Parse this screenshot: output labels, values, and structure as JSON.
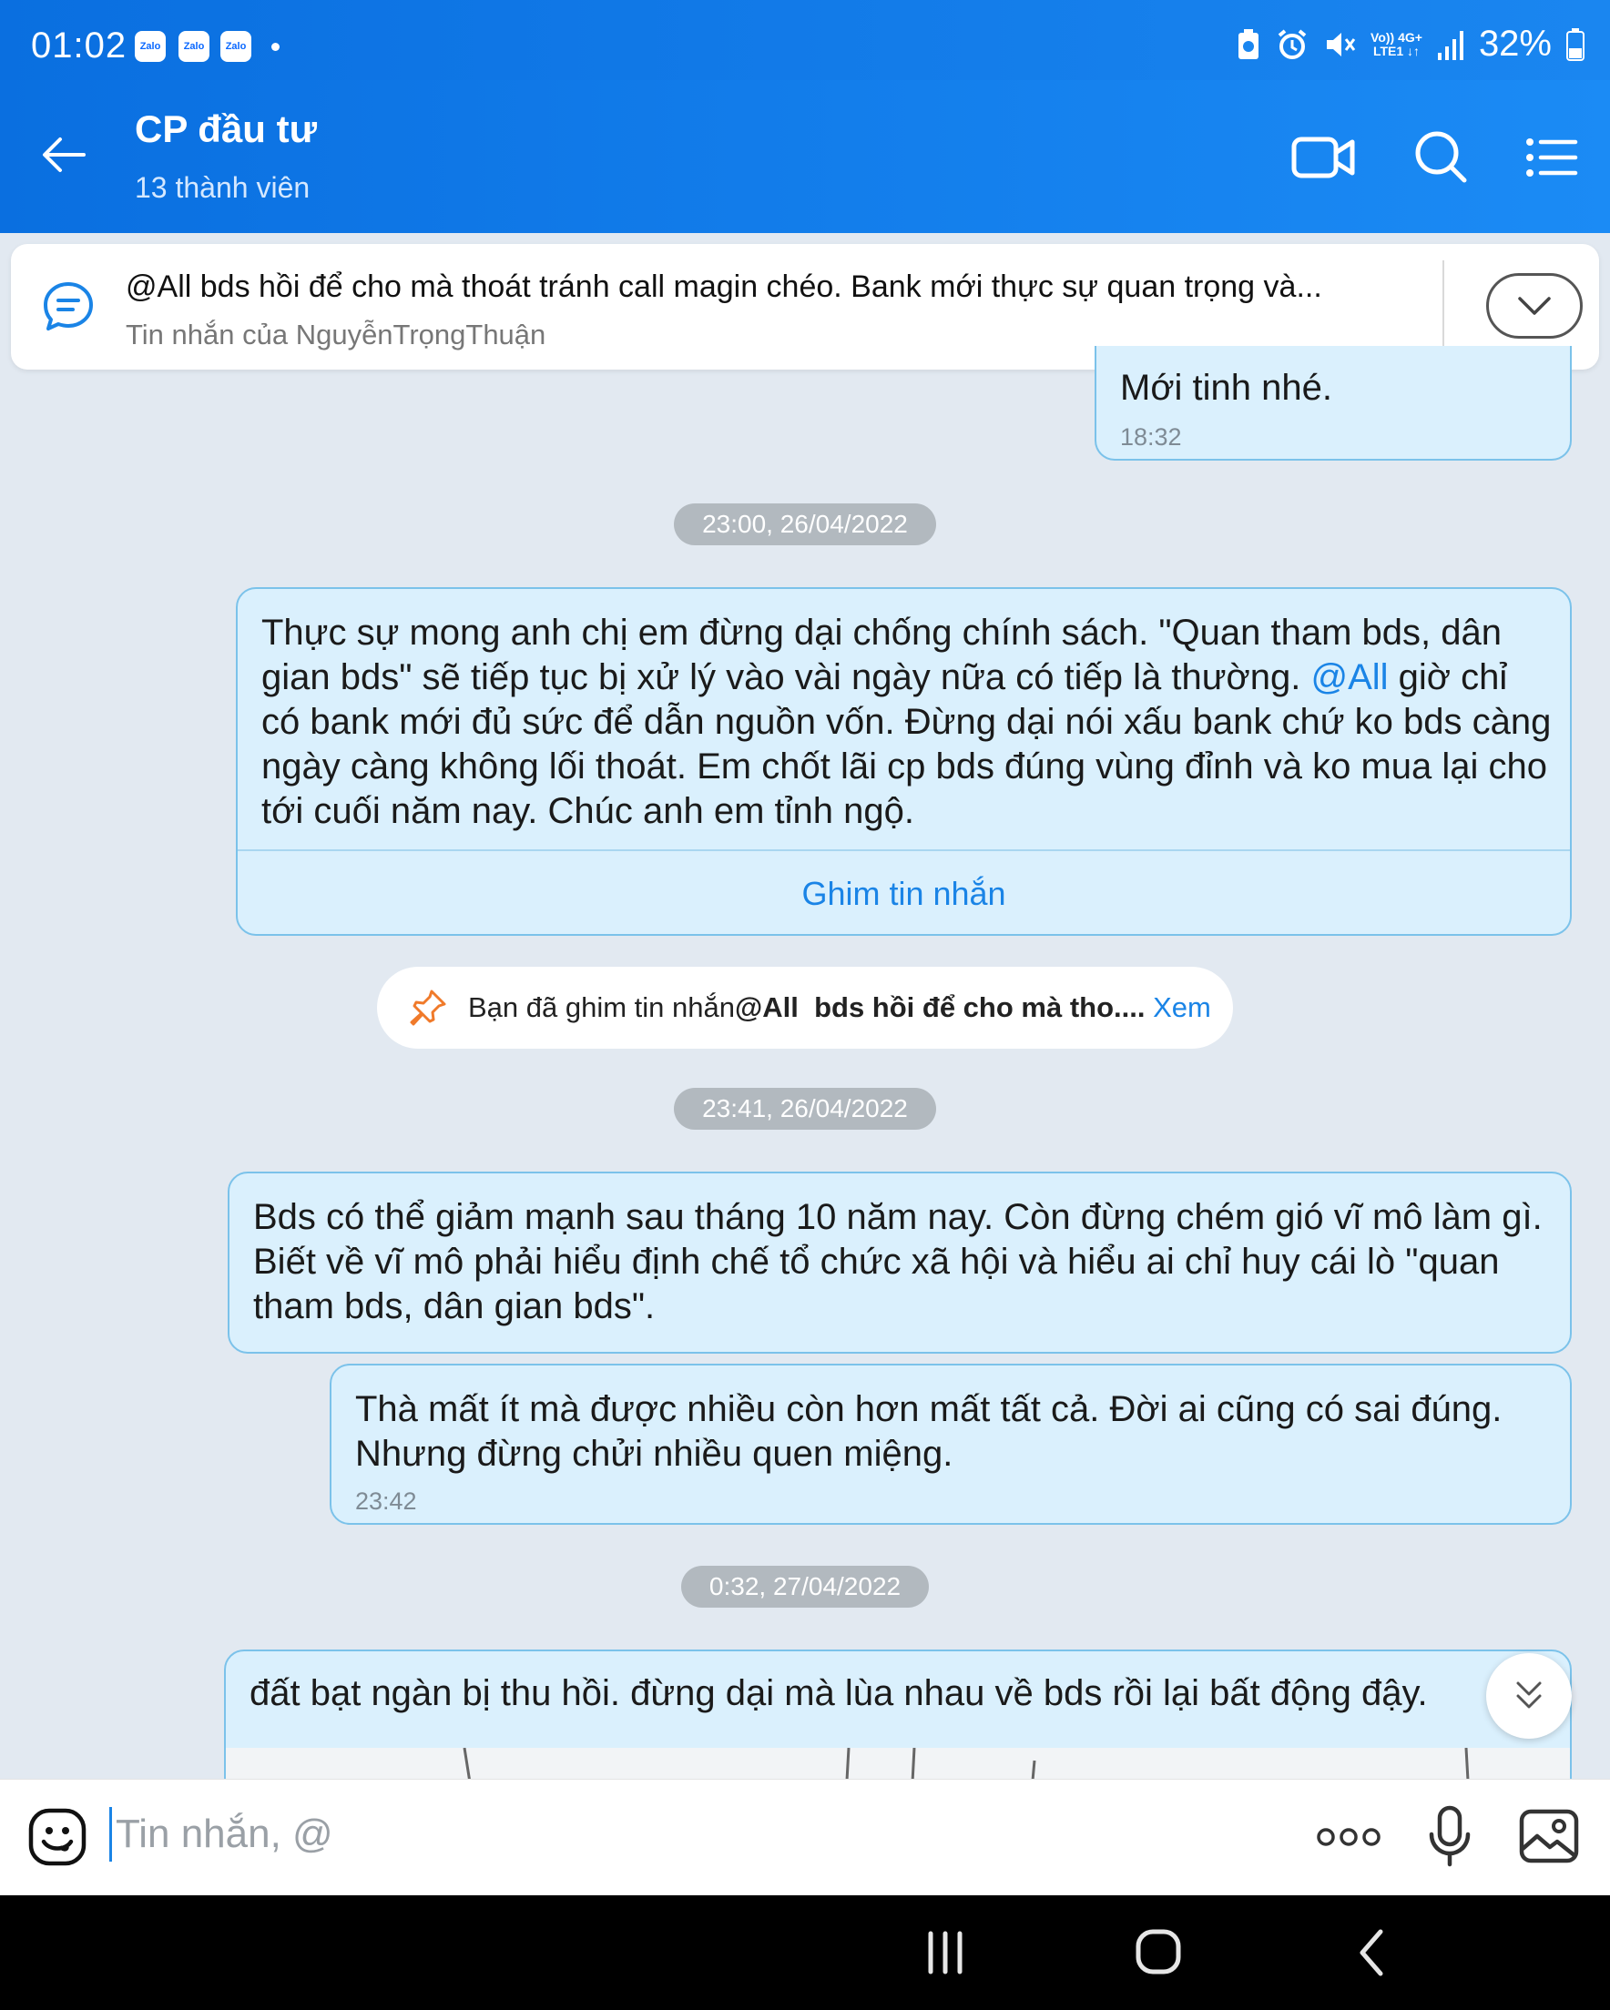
{
  "status_bar": {
    "time": "01:02",
    "notifications": [
      "Zalo",
      "Zalo",
      "Zalo"
    ],
    "network_top": "Vo)) 4G+",
    "network_bottom": "LTE1 ↓↑",
    "battery": "32%"
  },
  "header": {
    "title": "CP đầu tư",
    "subtitle": "13 thành viên"
  },
  "pinned": {
    "text": "@All  bds hồi để cho mà thoát tránh call magin chéo. Bank mới thực sự quan trọng và...",
    "sub": "Tin nhắn của NguyễnTrọngThuận"
  },
  "messages": {
    "m0": {
      "text": "Mới tinh nhé.",
      "time": "18:32"
    },
    "date1": "23:00, 26/04/2022",
    "m1": {
      "text_before": "Thực sự mong anh chị em đừng dại chống chính sách. \"Quan tham bds, dân gian bds\" sẽ tiếp tục bị xử lý vào vài ngày nữa có tiếp là thường. ",
      "mention": "@All",
      "text_after": " giờ chỉ có bank mới đủ sức để dẫn nguồn vốn. Đừng dại nói xấu bank chứ ko bds càng ngày càng không lối thoát. Em chốt lãi cp bds đúng vùng đỉnh và ko mua lại cho tới cuối năm nay. Chúc anh em tỉnh ngộ.",
      "action": "Ghim tin nhắn"
    },
    "pin_notice": {
      "prefix": "Bạn đã ghim tin nhắn ",
      "bold": "@All  bds hồi để cho mà tho....",
      "link": " Xem"
    },
    "date2": "23:41, 26/04/2022",
    "m2": {
      "text": "Bds có thể giảm mạnh sau tháng 10 năm nay. Còn đừng chém gió vĩ mô làm gì. Biết về vĩ mô phải hiểu định chế tổ chức xã hội và hiểu ai chỉ huy cái lò \"quan tham bds, dân gian bds\"."
    },
    "m3": {
      "text": "Thà mất ít mà được nhiều còn hơn mất tất cả. Đời ai cũng có sai đúng. Nhưng đừng chửi nhiều quen miệng.",
      "time": "23:42"
    },
    "date3": "0:32, 27/04/2022",
    "m4": {
      "text": "đất bạt ngàn bị thu hồi. đừng dại mà lùa nhau về bds rồi lại bất động đậy."
    }
  },
  "input": {
    "placeholder": "Tin nhắn, @"
  },
  "colors": {
    "accent": "#1a84e6",
    "header": "#0a6fe0",
    "bubble": "#daf0fd",
    "bubble_border": "#7bc2ea",
    "pin_icon": "#f07a2a"
  },
  "icons": [
    "back-arrow-icon",
    "video-call-icon",
    "search-icon",
    "menu-list-icon",
    "chat-bubble-icon",
    "chevron-down-icon",
    "pin-icon",
    "double-chevron-down-icon",
    "emoji-icon",
    "more-icon",
    "microphone-icon",
    "image-icon",
    "recent-apps-icon",
    "home-icon",
    "back-icon"
  ]
}
